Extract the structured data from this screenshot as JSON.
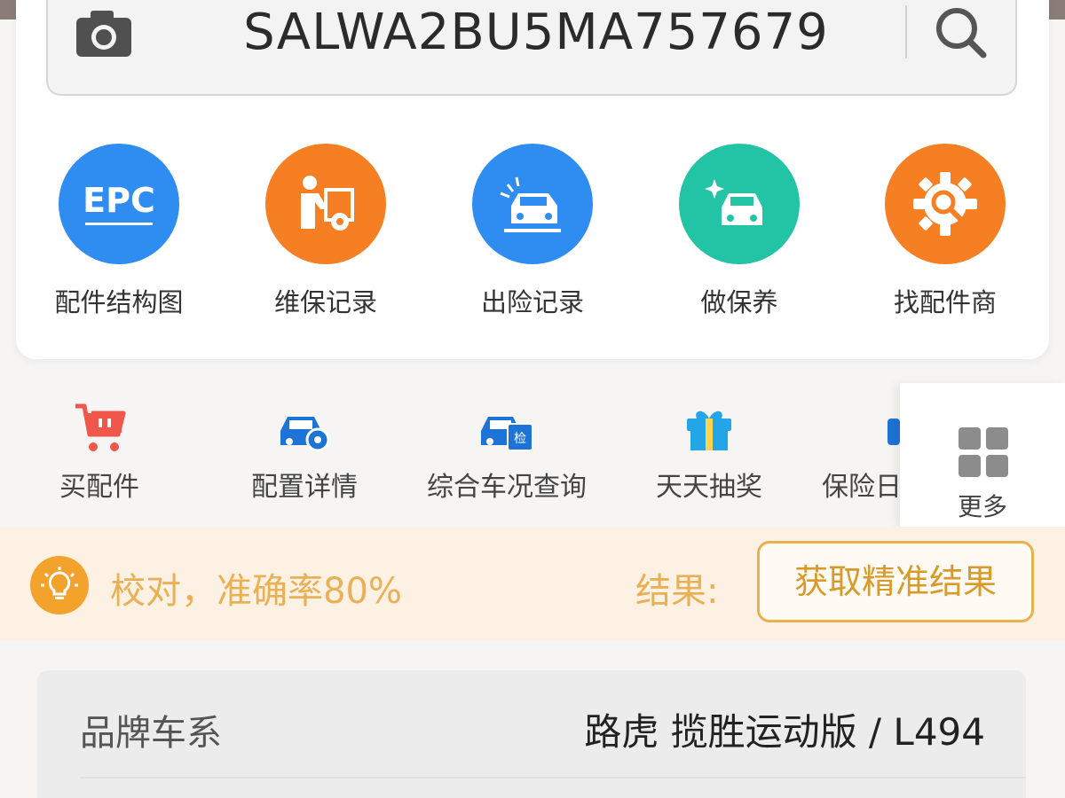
{
  "search": {
    "vin": "SALWA2BU5MA757679"
  },
  "features": [
    {
      "label": "配件结构图",
      "icon": "epc-icon",
      "icon_text": "EPC",
      "color": "#2f8cf0"
    },
    {
      "label": "维保记录",
      "icon": "mechanic-icon",
      "color": "#f57f22"
    },
    {
      "label": "出险记录",
      "icon": "car-accident-icon",
      "color": "#2f8cf0"
    },
    {
      "label": "做保养",
      "icon": "car-sparkle-icon",
      "color": "#23c3a5"
    },
    {
      "label": "找配件商",
      "icon": "gear-search-icon",
      "color": "#f57f22"
    }
  ],
  "tools": [
    {
      "label": "买配件",
      "icon": "shopping-cart-icon"
    },
    {
      "label": "配置详情",
      "icon": "car-config-icon"
    },
    {
      "label": "综合车况查询",
      "icon": "car-inspect-icon",
      "badge": "检"
    },
    {
      "label": "天天抽奖",
      "icon": "gift-icon"
    },
    {
      "label": "保险日",
      "icon": "insurance-icon"
    }
  ],
  "more": {
    "label": "更多",
    "icon": "grid-icon"
  },
  "notice": {
    "text": "校对，准确率80%",
    "result_label": "结果:",
    "button_label": "获取精准结果"
  },
  "vehicle_info": {
    "key": "品牌车系",
    "value": "路虎 揽胜运动版 / L494"
  },
  "colors": {
    "blue": "#2f8cf0",
    "orange": "#f57f22",
    "teal": "#23c3a5",
    "notice_text": "#e9b056",
    "notice_bg": "#fdf1e3"
  }
}
